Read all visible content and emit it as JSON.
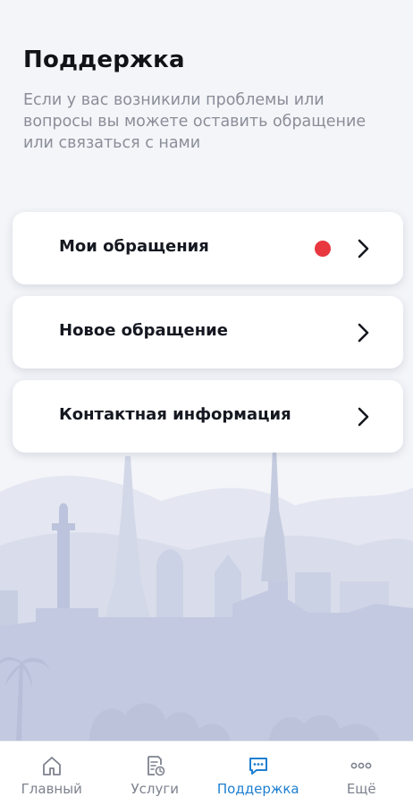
{
  "header": {
    "title": "Поддержка",
    "subtitle": "Если у вас возникили проблемы или вопросы вы можете оставить обращение или связаться с нами"
  },
  "menu": {
    "items": [
      {
        "label": "Мои обращения",
        "has_notification": true
      },
      {
        "label": "Новое обращение",
        "has_notification": false
      },
      {
        "label": "Контактная информация",
        "has_notification": false
      }
    ]
  },
  "tabbar": {
    "items": [
      {
        "label": "Главный",
        "icon": "home-icon",
        "active": false
      },
      {
        "label": "Услуги",
        "icon": "services-document-icon",
        "active": false
      },
      {
        "label": "Поддержка",
        "icon": "chat-support-icon",
        "active": true
      },
      {
        "label": "Ещё",
        "icon": "more-dots-icon",
        "active": false
      }
    ]
  },
  "colors": {
    "accent": "#1e7fd0",
    "notification": "#e8373f",
    "background": "#f4f5f9",
    "skyline": "#c3c9e0"
  }
}
